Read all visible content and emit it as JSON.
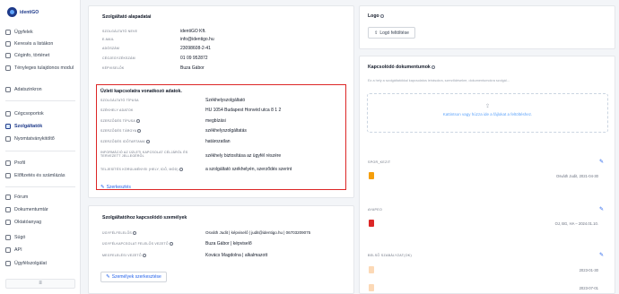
{
  "app": {
    "logo_text": "identiGO"
  },
  "sidebar": {
    "items": [
      {
        "label": "Ügyfelek"
      },
      {
        "label": "Keresés a listákon"
      },
      {
        "label": "Céginfo, történet"
      },
      {
        "label": "Tényleges tulajdonos modul"
      },
      {
        "label": "Adatszinkron"
      },
      {
        "label": "Cégcsoportok"
      },
      {
        "label": "Szolgáltatók"
      },
      {
        "label": "Nyomtatványkitöltő"
      },
      {
        "label": "Profil"
      },
      {
        "label": "Előfizetés és számlázás"
      },
      {
        "label": "Fórum"
      },
      {
        "label": "Dokumentumtár"
      },
      {
        "label": "Oktatóanyag"
      },
      {
        "label": "Súgó"
      },
      {
        "label": "API"
      },
      {
        "label": "Ügyfélszolgálat"
      }
    ],
    "collapse_icon": "≡"
  },
  "basic": {
    "title": "Szolgáltató alapadatai",
    "fields": [
      {
        "label": "Szolgáltató neve",
        "value": "identiGO Kft."
      },
      {
        "label": "E-mail",
        "value": "info@identigo.hu"
      },
      {
        "label": "Adószám",
        "value": "23098608-2-41"
      },
      {
        "label": "Cégjegyzékszám",
        "value": "01 09 952872"
      },
      {
        "label": "Képviselők",
        "value": "Buza Gábor"
      }
    ]
  },
  "business": {
    "title": "Üzleti kapcsolatra vonatkozó adatok.",
    "fields": [
      {
        "label": "Szolgáltató típusa",
        "value": "Székhelyszolgáltató"
      },
      {
        "label": "Székhely adatok",
        "value": "HU 1054 Budapest Honvéd utca 8 1 2"
      },
      {
        "label": "Szerződés típusa",
        "value": "megbízási"
      },
      {
        "label": "Szerződés tárgya",
        "value": "székhelyszolgáltatás"
      },
      {
        "label": "Szerződés időtartama",
        "value": "határozatlan"
      },
      {
        "label": "Információ az üzleti kapcsolat céljáról és tervezett jellegéről",
        "value": "székhely biztosítása az ügyfél részére"
      },
      {
        "label": "Teljesítés körülményei (hely, idő, mód)",
        "value": "a szolgáltató székhelyén, szerződés szerint"
      }
    ],
    "edit_label": "Szerkesztés"
  },
  "contacts": {
    "title": "Szolgáltatóhoz kapcsolódó személyek",
    "fields": [
      {
        "label": "Ügyfélfelelős",
        "value": "Osváth Judit | képviselő | judit@identigo.hu | 06703209075"
      },
      {
        "label": "Ügyfélkapcsolat felelős vezető",
        "value": "Buza Gábor | képviselő"
      },
      {
        "label": "Megfelelési vezető",
        "value": "Kovács Magdolna | alkalmazott"
      }
    ],
    "edit_label": "Személyek szerkesztése"
  },
  "logo_card": {
    "title": "Logo",
    "button_label": "Logó feltöltése"
  },
  "docs": {
    "title": "Kapcsolódó dokumentumok",
    "hint": "Ez a hely a szolgáltatókkal kapcsolatos leírásokra, szerződésekre, dokumentumokra szolgál...",
    "dropzone_text": "Kattintson vagy húzza ide a fájlokat a feltöltéshez.",
    "sections": [
      {
        "label": "Spor_kezit",
        "meta": "Osváth Judit, 2021-04-30"
      },
      {
        "label": "Ayapeo",
        "meta": "OJ, BG, HA – 2024.01.10."
      },
      {
        "label": "Belső szabályzat(ok)",
        "meta1": "2023-01-30",
        "meta2": "2023-07-01"
      }
    ]
  },
  "colors": {
    "accent": "#2563eb",
    "brand": "#1e3a8a",
    "highlight": "#dc2626",
    "pdf": "#dc2626",
    "file": "#f59e0b"
  }
}
